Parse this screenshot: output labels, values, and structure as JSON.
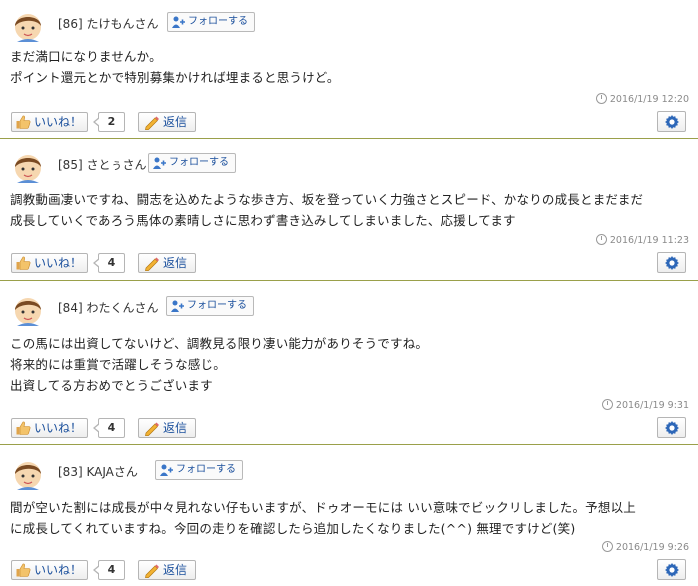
{
  "comments": [
    {
      "number": "[86]",
      "username": "たけもんさん",
      "follow_label": "フォローする",
      "lines": [
        "まだ満口になりませんか。",
        "ポイント還元とかで特別募集かければ埋まると思うけど。"
      ],
      "timestamp": "2016/1/19 12:20",
      "like_label": "いいね！",
      "like_count": "2",
      "reply_label": "返信"
    },
    {
      "number": "[85]",
      "username": "さとぅさん",
      "follow_label": "フォローする",
      "lines": [
        "調教動画凄いですね、闘志を込めたような歩き方、坂を登っていく力強さとスピード、かなりの成長とまだまだ",
        "成長していくであろう馬体の素晴しさに思わず書き込みしてしまいました、応援してます"
      ],
      "timestamp": "2016/1/19 11:23",
      "like_label": "いいね！",
      "like_count": "4",
      "reply_label": "返信"
    },
    {
      "number": "[84]",
      "username": "わたくんさん",
      "follow_label": "フォローする",
      "lines": [
        "この馬には出資してないけど、調教見る限り凄い能力がありそうですね。",
        "将来的には重賞で活躍しそうな感じ。",
        "出資してる方おめでとうございます"
      ],
      "timestamp": "2016/1/19 9:31",
      "like_label": "いいね！",
      "like_count": "4",
      "reply_label": "返信"
    },
    {
      "number": "[83]",
      "username": "KAJAさん",
      "follow_label": "フォローする",
      "lines": [
        "間が空いた割には成長が中々見れない仔もいますが、ドゥオーモには いい意味でビックリしました。予想以上",
        "に成長してくれていますね。今回の走りを確認したら追加したくなりました(^^) 無理ですけど(笑)"
      ],
      "timestamp": "2016/1/19 9:26",
      "like_label": "いいね！",
      "like_count": "4",
      "reply_label": "返信"
    }
  ],
  "colors": {
    "link": "#1a4f9c",
    "separator": "#9aa04a",
    "timestamp": "#8a8a8a"
  },
  "icons": [
    "avatar-boy",
    "follow-user-icon",
    "thumbs-up-icon",
    "pencil-icon",
    "gear-icon",
    "clock-icon"
  ]
}
